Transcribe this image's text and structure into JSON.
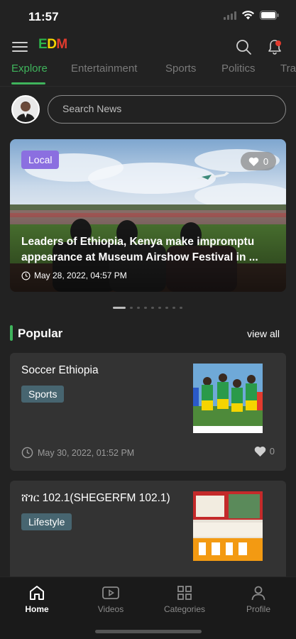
{
  "status": {
    "time": "11:57"
  },
  "header": {
    "logo": {
      "e": "E",
      "d": "D",
      "m": "M"
    },
    "menu_icon": "hamburger-icon",
    "search_icon": "search-icon",
    "bell_icon": "bell-icon",
    "notification_dot_color": "#e23b2e"
  },
  "tabs": [
    {
      "label": "Explore",
      "active": true
    },
    {
      "label": "Entertainment"
    },
    {
      "label": "Sports"
    },
    {
      "label": "Politics"
    },
    {
      "label": "Tra"
    }
  ],
  "search": {
    "placeholder": "Search News"
  },
  "featured": {
    "badge": "Local",
    "likes": "0",
    "title_line1": "Leaders of Ethiopia, Kenya make impromptu",
    "title_line2": "appearance at Museum Airshow Festival in ...",
    "date": "May 28, 2022, 04:57 PM",
    "slide_count": 9,
    "active_slide": 1
  },
  "popular": {
    "title": "Popular",
    "view_all": "view all",
    "items": [
      {
        "title": "Soccer Ethiopia",
        "tag": "Sports",
        "date": "May 30, 2022, 01:52 PM",
        "likes": "0"
      },
      {
        "title": "ሸገር 102.1(SHEGERFM 102.1)",
        "tag": "Lifestyle",
        "date": "",
        "likes": ""
      }
    ]
  },
  "bottom_nav": [
    {
      "label": "Home",
      "icon": "home-icon",
      "active": true
    },
    {
      "label": "Videos",
      "icon": "video-icon"
    },
    {
      "label": "Categories",
      "icon": "grid-icon"
    },
    {
      "label": "Profile",
      "icon": "user-icon"
    }
  ],
  "colors": {
    "accent": "#3fb45c",
    "local_badge": "#8b6fe0",
    "tag": "#476570",
    "background": "#222222",
    "card": "#333333"
  }
}
